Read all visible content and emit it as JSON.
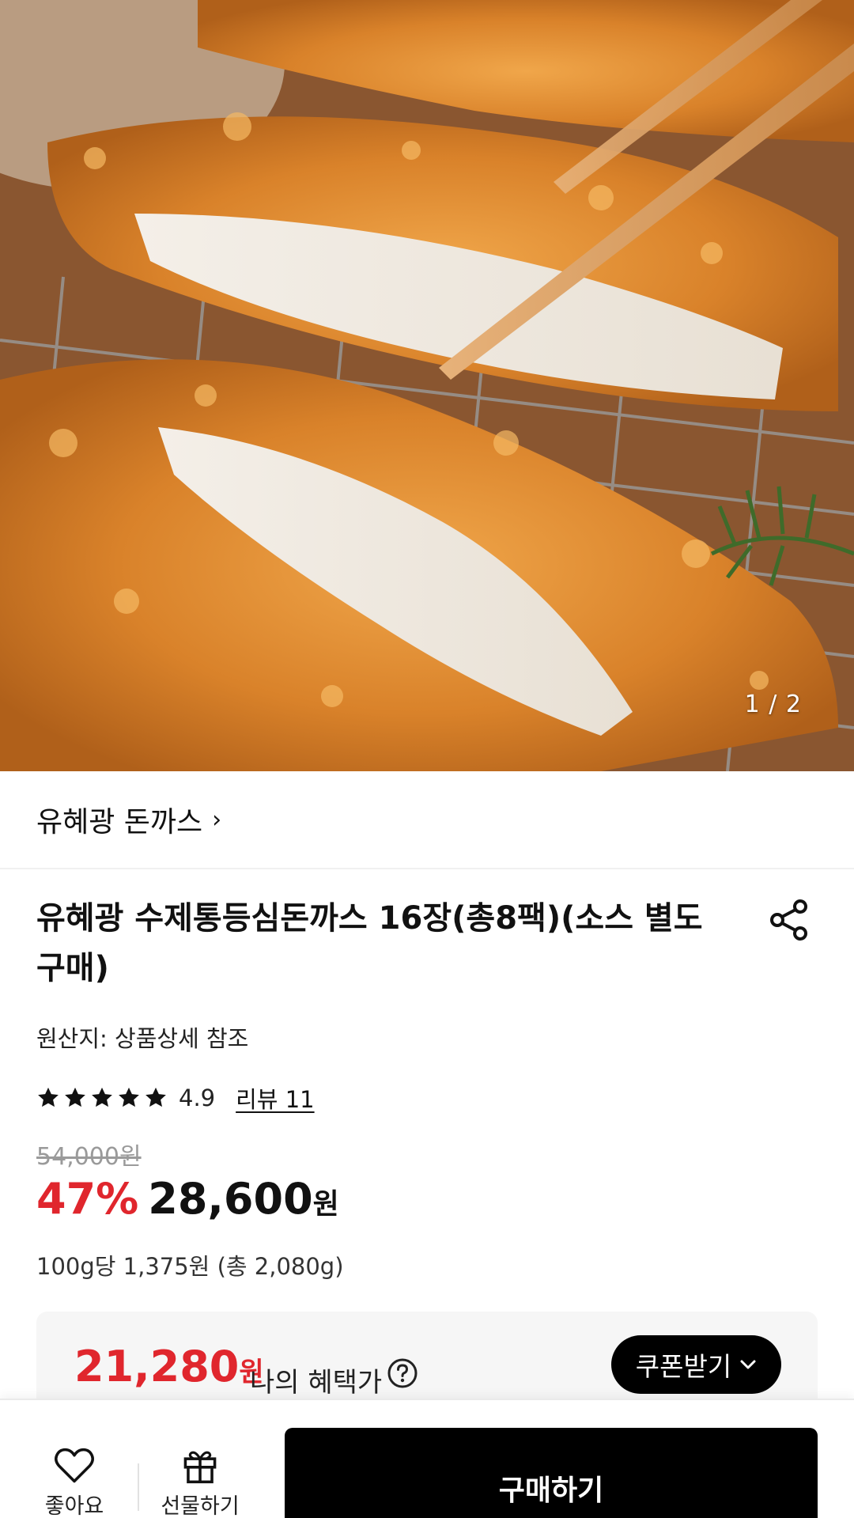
{
  "hero": {
    "image_alt": "tonkatsu-photo",
    "counter": "1 / 2"
  },
  "brand": {
    "name": "유혜광 돈까스",
    "chevron": "›"
  },
  "product": {
    "title": "유혜광 수제통등심돈까스 16장(총8팩)(소스 별도구매)",
    "origin": "원산지: 상품상세 참조",
    "rating": "4.9",
    "rating_stars": 5,
    "review_link": "리뷰 11",
    "original_price": "54,000원",
    "discount": "47%",
    "price": "28,600",
    "price_unit": "원",
    "unit_price": "100g당 1,375원 (총 2,080g)"
  },
  "benefit": {
    "price": "21,280",
    "price_unit": "원",
    "label": "나의 혜택가",
    "coupon_button": "쿠폰받기"
  },
  "bottom_bar": {
    "like_label": "좋아요",
    "gift_label": "선물하기",
    "buy_label": "구매하기"
  },
  "colors": {
    "accent_red": "#e0262d",
    "button_black": "#000000",
    "benefit_bg": "#f6f6f6"
  }
}
